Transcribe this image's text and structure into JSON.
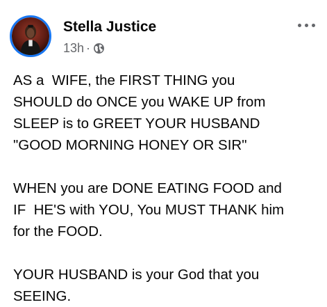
{
  "post": {
    "author": {
      "name": "Stella Justice",
      "avatar_icon": "profile-photo"
    },
    "meta": {
      "time": "13h",
      "separator": "·",
      "audience_icon": "globe-icon"
    },
    "more_icon": "more-options-icon",
    "paragraphs": [
      {
        "lines": [
          "AS a  WIFE, the FIRST THING you",
          "SHOULD do ONCE you WAKE UP from",
          "SLEEP is to GREET YOUR HUSBAND",
          "\"GOOD MORNING HONEY OR SIR\""
        ]
      },
      {
        "lines": [
          "WHEN you are DONE EATING FOOD and",
          "IF  HE'S with YOU, You MUST THANK him",
          "for the FOOD."
        ]
      },
      {
        "lines": [
          "YOUR HUSBAND is your God that you",
          "SEEING."
        ]
      }
    ]
  },
  "colors": {
    "avatar_ring": "#1877f2",
    "secondary_text": "#65676b",
    "primary_text": "#050505"
  }
}
